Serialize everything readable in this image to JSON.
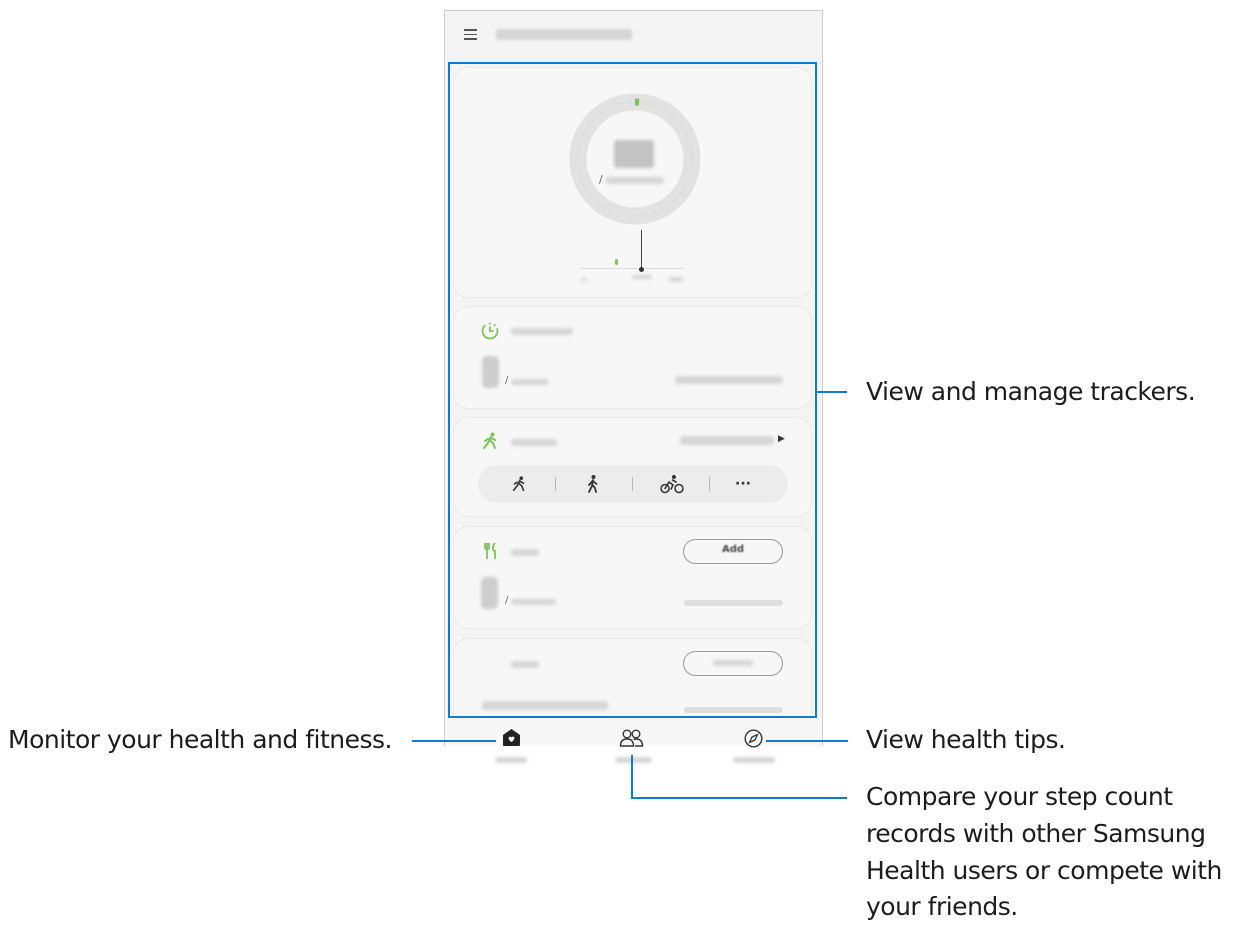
{
  "app": {
    "navigation": {
      "tabs": [
        {
          "name": "home",
          "icon": "home-icon"
        },
        {
          "name": "together",
          "icon": "people-icon"
        },
        {
          "name": "discover",
          "icon": "compass-icon"
        }
      ]
    },
    "steps_card": {
      "progress_symbol": "/"
    },
    "active_time_card": {
      "icon": "timer-icon",
      "progress_symbol": "/"
    },
    "exercise_card": {
      "icon": "running-icon",
      "more_arrow": "▶",
      "quick_options": [
        {
          "icon": "running-icon"
        },
        {
          "icon": "walking-icon"
        },
        {
          "icon": "cycling-icon"
        },
        {
          "icon": "more-icon",
          "label": "···"
        }
      ]
    },
    "food_card": {
      "icon": "food-icon",
      "button_label": "Add",
      "progress_symbol": "/"
    },
    "sleep_card": {
      "icon": "moon-icon"
    }
  },
  "accent_color": "#7dc35b",
  "callout_color": "#0d7bd1",
  "annotations": {
    "trackers": "View and manage trackers.",
    "home": "Monitor your health and fitness.",
    "discover": "View health tips.",
    "together_line1": "Compare your step count",
    "together_line2": "records with other Samsung",
    "together_line3": "Health users or compete with",
    "together_line4": "your friends."
  }
}
